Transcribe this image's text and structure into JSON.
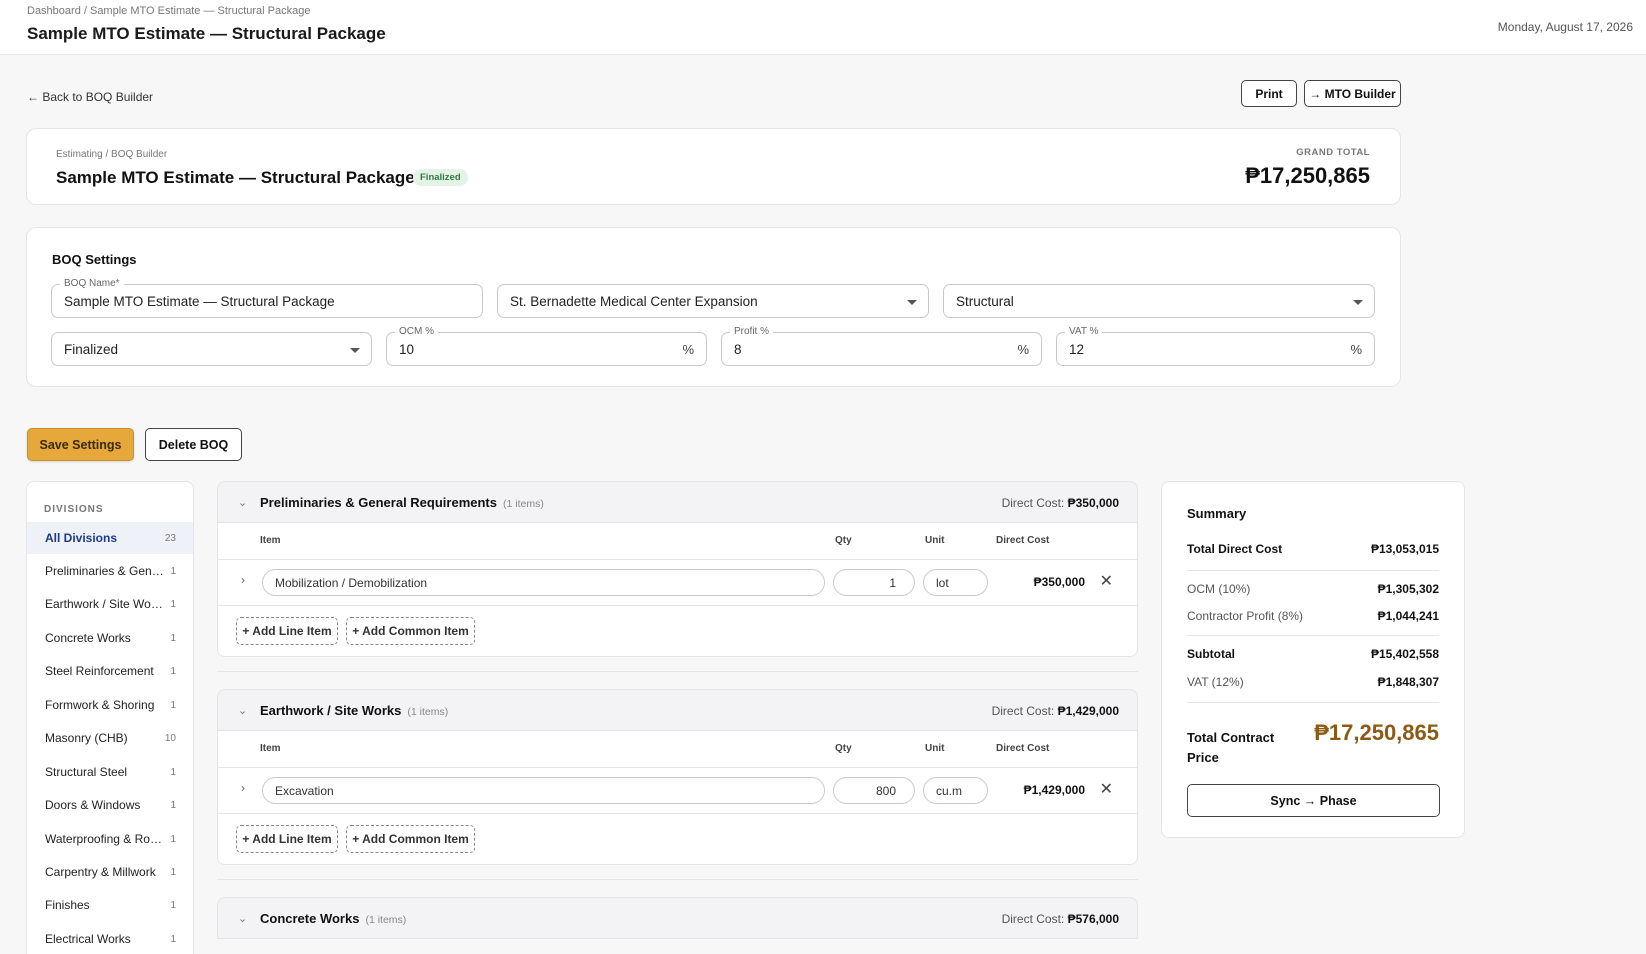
{
  "topbar": {
    "breadcrumb": "Dashboard / Sample MTO Estimate — Structural Package",
    "title": "Sample MTO Estimate — Structural Package",
    "date": "Monday, August 17, 2026"
  },
  "actions": {
    "back": "← Back to BOQ Builder",
    "print": "Print",
    "mto_builder": "→ MTO Builder"
  },
  "header": {
    "breadcrumb": "Estimating / BOQ Builder",
    "title": "Sample MTO Estimate — Structural Package",
    "status_badge": "Finalized",
    "grand_total_label": "GRAND TOTAL",
    "grand_total": "₱17,250,865"
  },
  "settings": {
    "title": "BOQ Settings",
    "boq_name_label": "BOQ Name*",
    "boq_name": "Sample MTO Estimate — Structural Package",
    "project": "St. Bernadette Medical Center Expansion",
    "category": "Structural",
    "status": "Finalized",
    "ocm_label": "OCM %",
    "ocm": "10",
    "profit_label": "Profit %",
    "profit": "8",
    "vat_label": "VAT %",
    "vat": "12",
    "percent_suffix": "%",
    "save": "Save Settings",
    "delete": "Delete BOQ"
  },
  "sidebar": {
    "heading": "DIVISIONS",
    "items": [
      {
        "label": "All Divisions",
        "count": "23"
      },
      {
        "label": "Preliminaries & General Requirements",
        "count": "1"
      },
      {
        "label": "Earthwork / Site Works",
        "count": "1"
      },
      {
        "label": "Concrete Works",
        "count": "1"
      },
      {
        "label": "Steel Reinforcement",
        "count": "1"
      },
      {
        "label": "Formwork & Shoring",
        "count": "1"
      },
      {
        "label": "Masonry (CHB)",
        "count": "10"
      },
      {
        "label": "Structural Steel",
        "count": "1"
      },
      {
        "label": "Doors & Windows",
        "count": "1"
      },
      {
        "label": "Waterproofing & Roofing",
        "count": "1"
      },
      {
        "label": "Carpentry & Millwork",
        "count": "1"
      },
      {
        "label": "Finishes",
        "count": "1"
      },
      {
        "label": "Electrical Works",
        "count": "1"
      }
    ]
  },
  "columns": {
    "item": "Item",
    "qty": "Qty",
    "unit": "Unit",
    "direct_cost": "Direct Cost"
  },
  "divisions": [
    {
      "name": "Preliminaries & General Requirements",
      "count": "(1 items)",
      "direct_cost_label": "Direct Cost:",
      "direct_cost": "₱350,000",
      "line": {
        "item": "Mobilization / Demobilization",
        "qty": "1",
        "unit": "lot",
        "cost": "₱350,000"
      },
      "add_line": "+ Add Line Item",
      "add_common": "+ Add Common Item"
    },
    {
      "name": "Earthwork / Site Works",
      "count": "(1 items)",
      "direct_cost_label": "Direct Cost:",
      "direct_cost": "₱1,429,000",
      "line": {
        "item": "Excavation",
        "qty": "800",
        "unit": "cu.m",
        "cost": "₱1,429,000"
      },
      "add_line": "+ Add Line Item",
      "add_common": "+ Add Common Item"
    },
    {
      "name": "Concrete Works",
      "count": "(1 items)",
      "direct_cost_label": "Direct Cost:",
      "direct_cost": "₱576,000"
    }
  ],
  "summary": {
    "title": "Summary",
    "total_direct_cost_label": "Total Direct Cost",
    "total_direct_cost": "₱13,053,015",
    "ocm_label": "OCM (10%)",
    "ocm": "₱1,305,302",
    "profit_label": "Contractor Profit (8%)",
    "profit": "₱1,044,241",
    "subtotal_label": "Subtotal",
    "subtotal": "₱15,402,558",
    "vat_label": "VAT (12%)",
    "vat": "₱1,848,307",
    "tcp_label": "Total Contract Price",
    "tcp": "₱17,250,865",
    "sync": "Sync → Phase"
  }
}
